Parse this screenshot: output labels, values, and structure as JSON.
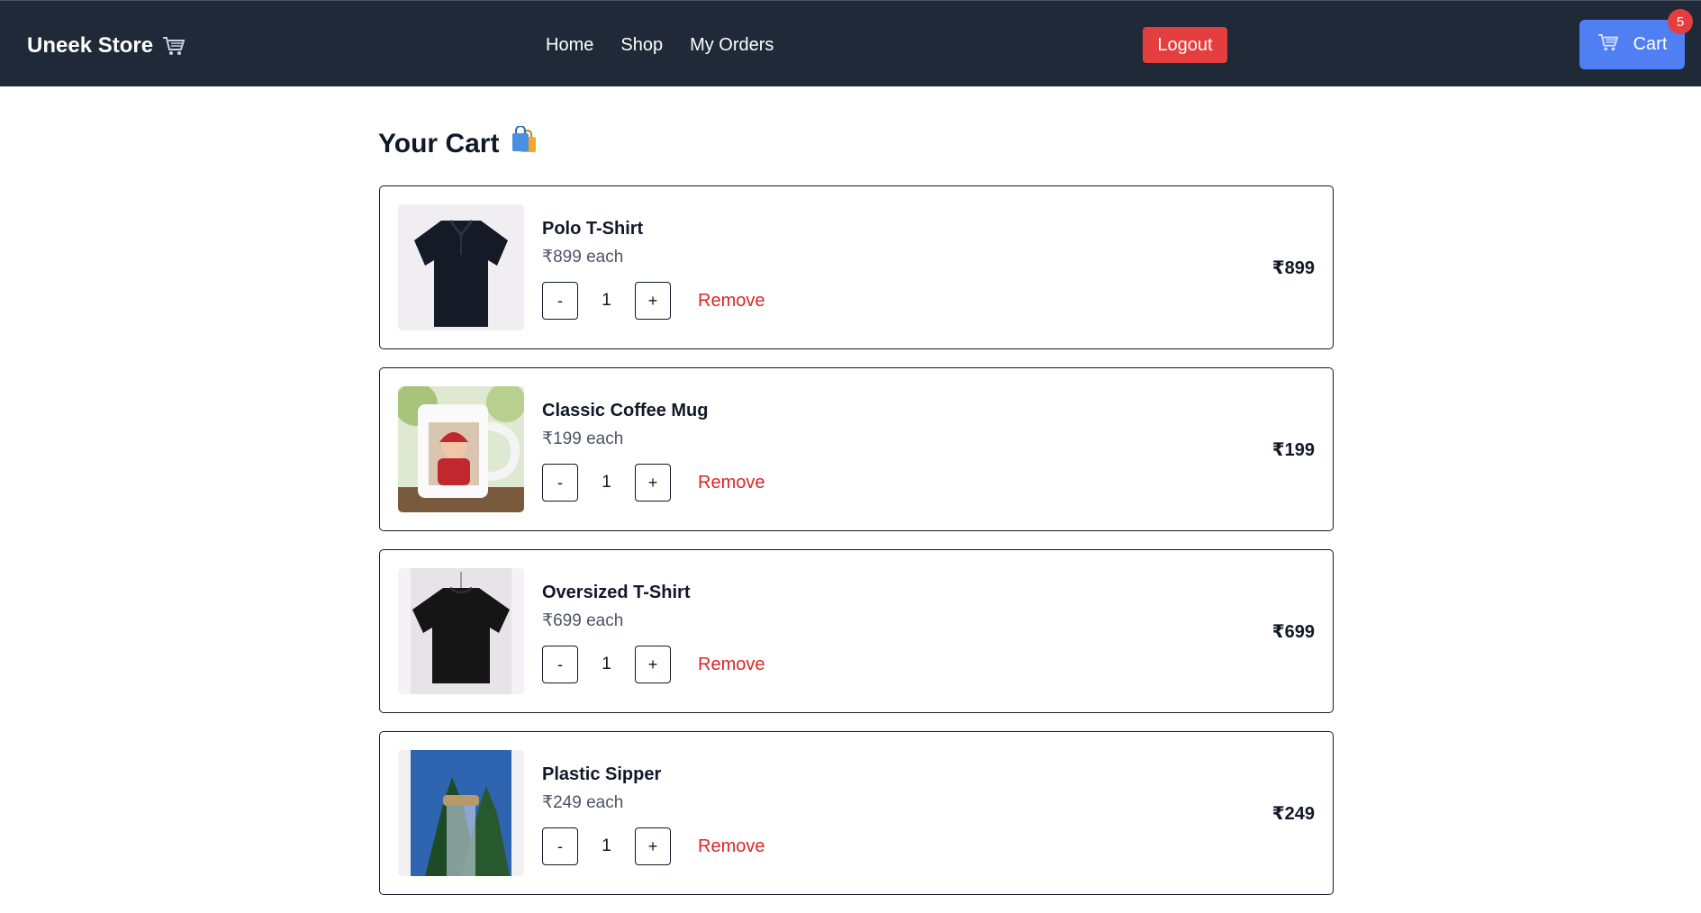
{
  "header": {
    "brand": "Uneek Store",
    "nav": [
      "Home",
      "Shop",
      "My Orders"
    ],
    "logout_label": "Logout",
    "cart_label": "Cart",
    "cart_count": "5"
  },
  "page": {
    "title": "Your Cart"
  },
  "cart": {
    "remove_label": "Remove",
    "decrement_label": "-",
    "increment_label": "+",
    "items": [
      {
        "name": "Polo T-Shirt",
        "each": "₹899 each",
        "qty": "1",
        "total": "₹899",
        "image": "polo-shirt"
      },
      {
        "name": "Classic Coffee Mug",
        "each": "₹199 each",
        "qty": "1",
        "total": "₹199",
        "image": "coffee-mug"
      },
      {
        "name": "Oversized T-Shirt",
        "each": "₹699 each",
        "qty": "1",
        "total": "₹699",
        "image": "oversized-tshirt"
      },
      {
        "name": "Plastic Sipper",
        "each": "₹249 each",
        "qty": "1",
        "total": "₹249",
        "image": "plastic-sipper"
      }
    ]
  },
  "colors": {
    "navbar": "#1f2937",
    "logout": "#e53e3e",
    "cart_button": "#4f7ff3",
    "remove": "#dc2626"
  }
}
